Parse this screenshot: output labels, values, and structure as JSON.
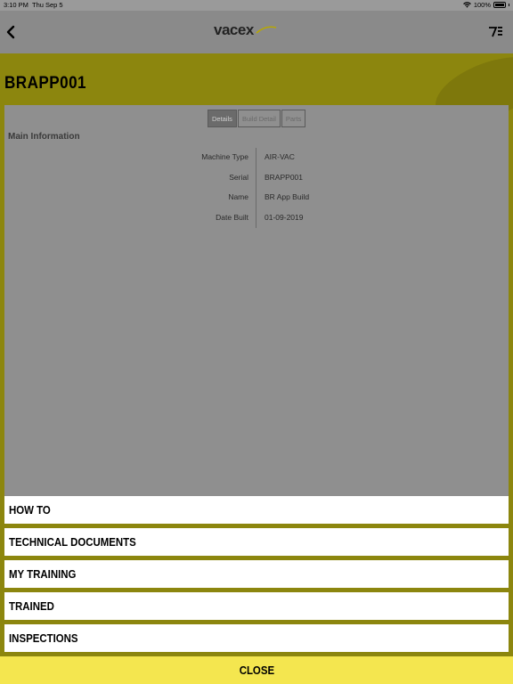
{
  "status_bar": {
    "time": "3:10 PM",
    "date": "Thu Sep 5",
    "battery": "100%"
  },
  "nav": {
    "logo_text": "vacex",
    "back_icon": "chevron-left-icon",
    "menu_icon": "list-menu-icon"
  },
  "machine": {
    "title": "BRAPP001"
  },
  "tabs": [
    {
      "label": "Details",
      "active": true
    },
    {
      "label": "Build Detail",
      "active": false
    },
    {
      "label": "Parts",
      "active": false
    }
  ],
  "main_info": {
    "section_title": "Main Information",
    "rows": [
      {
        "label": "Machine Type",
        "value": "AIR-VAC"
      },
      {
        "label": "Serial",
        "value": "BRAPP001"
      },
      {
        "label": "Name",
        "value": "BR App Build"
      },
      {
        "label": "Date Built",
        "value": "01-09-2019"
      }
    ]
  },
  "menu": {
    "items": [
      {
        "label": "HOW TO"
      },
      {
        "label": "TECHNICAL DOCUMENTS"
      },
      {
        "label": "MY TRAINING"
      },
      {
        "label": "TRAINED"
      },
      {
        "label": "INSPECTIONS"
      }
    ]
  },
  "close_label": "CLOSE",
  "colors": {
    "accent_yellow": "#f4e64f",
    "header_olive": "#8c860e",
    "overlay_gray": "#8a8a8a"
  }
}
